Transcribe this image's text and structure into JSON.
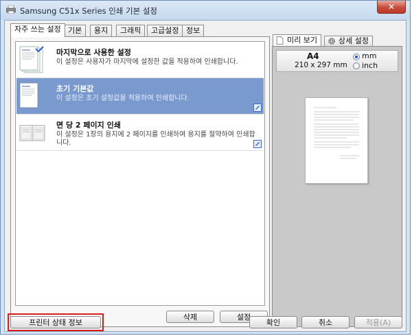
{
  "window": {
    "title": "Samsung C51x Series 인쇄 기본 설정",
    "close_label": "✕"
  },
  "tabs": [
    {
      "label": "자주 쓰는 설정",
      "active": true
    },
    {
      "label": "기본"
    },
    {
      "label": "용지"
    },
    {
      "label": "그래픽"
    },
    {
      "label": "고급설정"
    },
    {
      "label": "정보"
    }
  ],
  "presets": [
    {
      "title": "마지막으로 사용한 설정",
      "desc": "이 설정은 사용자가 마지막에 설정한 값을 적용하여 인쇄합니다.",
      "selected": false
    },
    {
      "title": "초기 기본값",
      "desc": "이 설정은 초기 설정값을 적용하여 인쇄합니다.",
      "selected": true
    },
    {
      "title": "면 당 2 페이지 인쇄",
      "desc": "이 설정은 1장의 용지에 2 페이지를 인쇄하여 용지를 절약하여 인쇄합니다.",
      "selected": false
    }
  ],
  "panel_buttons": {
    "delete": "삭제",
    "settings": "설정"
  },
  "preview": {
    "tab_preview": "미리 보기",
    "tab_details": "상세 설정",
    "paper_name": "A4",
    "paper_dims": "210 x 297 mm",
    "unit_mm": "mm",
    "unit_inch": "inch",
    "selected_unit": "mm"
  },
  "footer": {
    "printer_status": "프린터 상태 정보",
    "ok": "확인",
    "cancel": "취소",
    "apply": "적용(A)"
  },
  "colors": {
    "selected_row": "#7a9acf",
    "highlight_border": "#d81c1c"
  }
}
